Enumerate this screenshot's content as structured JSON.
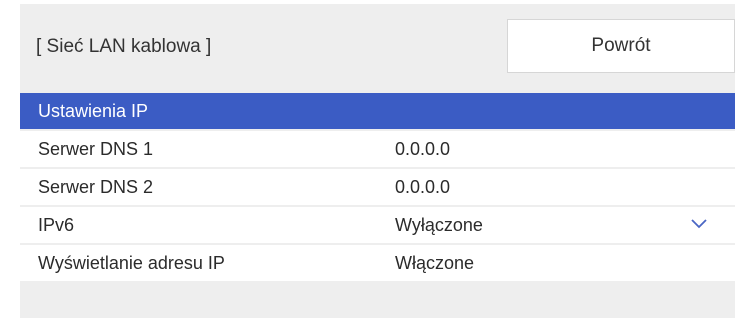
{
  "header": {
    "title": "[ Sieć LAN kablowa ]",
    "back_label": "Powrót"
  },
  "menu": {
    "items": [
      {
        "label": "Ustawienia IP",
        "value": "",
        "selected": true
      },
      {
        "label": "Serwer DNS 1",
        "value": "0.0.0.0"
      },
      {
        "label": "Serwer DNS 2",
        "value": "0.0.0.0"
      },
      {
        "label": "IPv6",
        "value": "Wyłączone",
        "icon": "chevron-down-icon"
      },
      {
        "label": "Wyświetlanie adresu IP",
        "value": "Włączone"
      }
    ]
  },
  "colors": {
    "selected_row": "#3b5cc4",
    "panel_background": "#eeeeee",
    "row_background": "#ffffff",
    "accent_icon": "#4a66c4"
  }
}
